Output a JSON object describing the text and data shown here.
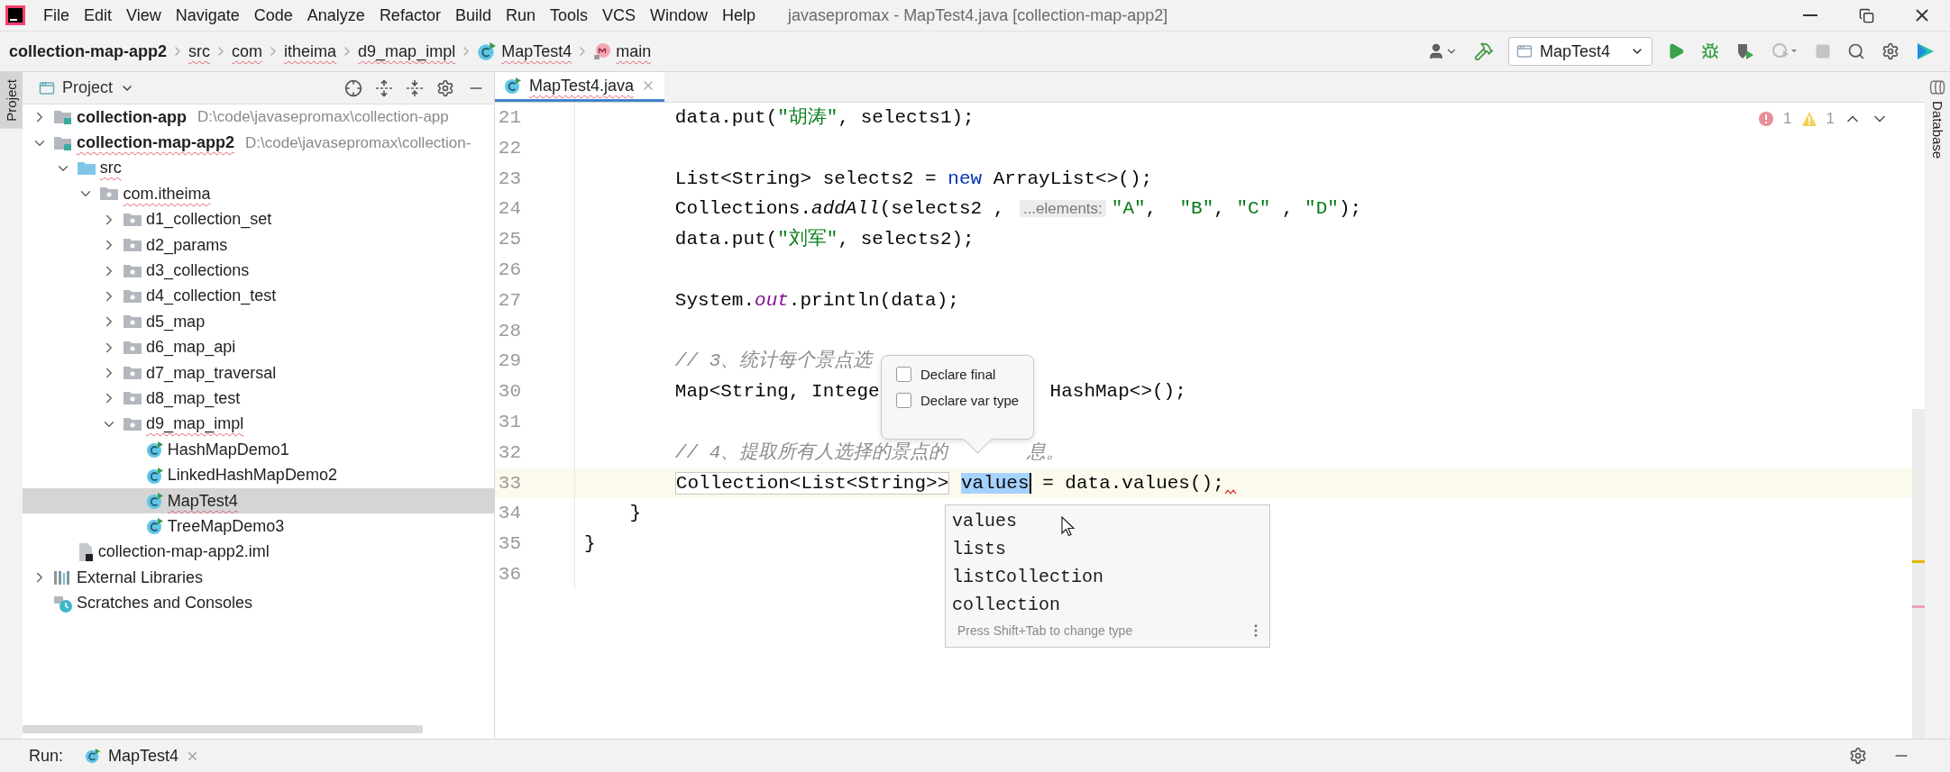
{
  "title_bar": {
    "menus": [
      "File",
      "Edit",
      "View",
      "Navigate",
      "Code",
      "Analyze",
      "Refactor",
      "Build",
      "Run",
      "Tools",
      "VCS",
      "Window",
      "Help"
    ],
    "title": "javasepromax - MapTest4.java [collection-map-app2]"
  },
  "breadcrumbs": [
    {
      "label": "collection-map-app2",
      "kind": "project",
      "error": false
    },
    {
      "label": "src",
      "kind": "folder",
      "error": true
    },
    {
      "label": "com",
      "kind": "folder",
      "error": true
    },
    {
      "label": "itheima",
      "kind": "folder",
      "error": true
    },
    {
      "label": "d9_map_impl",
      "kind": "folder",
      "error": true
    },
    {
      "label": "MapTest4",
      "kind": "class",
      "error": true
    },
    {
      "label": "main",
      "kind": "method",
      "error": true
    }
  ],
  "run_config": {
    "label": "MapTest4"
  },
  "left_stripe": {
    "label": "Project"
  },
  "project_panel": {
    "title": "Project",
    "tree": [
      {
        "label": "collection-app",
        "path": "D:\\code\\javasepromax\\collection-app",
        "kind": "module",
        "expanded": false,
        "selected": false,
        "error": false
      },
      {
        "label": "collection-map-app2",
        "path": "D:\\code\\javasepromax\\collection-",
        "kind": "module",
        "expanded": true,
        "selected": false,
        "error": true,
        "children": [
          {
            "label": "src",
            "kind": "source-folder",
            "expanded": true,
            "selected": false,
            "error": true,
            "children": [
              {
                "label": "com.itheima",
                "kind": "package",
                "expanded": true,
                "selected": false,
                "error": true,
                "children": [
                  {
                    "label": "d1_collection_set",
                    "kind": "package",
                    "expanded": false,
                    "selected": false,
                    "error": false
                  },
                  {
                    "label": "d2_params",
                    "kind": "package",
                    "expanded": false,
                    "selected": false,
                    "error": false
                  },
                  {
                    "label": "d3_collections",
                    "kind": "package",
                    "expanded": false,
                    "selected": false,
                    "error": false
                  },
                  {
                    "label": "d4_collection_test",
                    "kind": "package",
                    "expanded": false,
                    "selected": false,
                    "error": false
                  },
                  {
                    "label": "d5_map",
                    "kind": "package",
                    "expanded": false,
                    "selected": false,
                    "error": false
                  },
                  {
                    "label": "d6_map_api",
                    "kind": "package",
                    "expanded": false,
                    "selected": false,
                    "error": false
                  },
                  {
                    "label": "d7_map_traversal",
                    "kind": "package",
                    "expanded": false,
                    "selected": false,
                    "error": false
                  },
                  {
                    "label": "d8_map_test",
                    "kind": "package",
                    "expanded": false,
                    "selected": false,
                    "error": false
                  },
                  {
                    "label": "d9_map_impl",
                    "kind": "package",
                    "expanded": true,
                    "selected": false,
                    "error": true,
                    "children": [
                      {
                        "label": "HashMapDemo1",
                        "kind": "class",
                        "selected": false,
                        "error": false
                      },
                      {
                        "label": "LinkedHashMapDemo2",
                        "kind": "class",
                        "selected": false,
                        "error": false
                      },
                      {
                        "label": "MapTest4",
                        "kind": "class",
                        "selected": true,
                        "error": true
                      },
                      {
                        "label": "TreeMapDemo3",
                        "kind": "class",
                        "selected": false,
                        "error": false
                      }
                    ]
                  }
                ]
              }
            ]
          },
          {
            "label": "collection-map-app2.iml",
            "kind": "iml-file",
            "selected": false,
            "error": false
          }
        ]
      },
      {
        "label": "External Libraries",
        "kind": "libraries",
        "expanded": false,
        "selected": false,
        "error": false
      },
      {
        "label": "Scratches and Consoles",
        "kind": "scratches",
        "selected": false,
        "error": false
      }
    ]
  },
  "editor": {
    "tab": {
      "label": "MapTest4.java",
      "selected": true,
      "error": true
    },
    "problems": {
      "errors": "1",
      "warnings": "1"
    },
    "lines": [
      {
        "number": "21",
        "current": false,
        "tokens": [
          {
            "text": "        data.put(",
            "kind": "plain"
          },
          {
            "text": "\"胡涛\"",
            "kind": "string"
          },
          {
            "text": ", selects1);",
            "kind": "plain"
          }
        ]
      },
      {
        "number": "22",
        "current": false
      },
      {
        "number": "23",
        "current": false,
        "tokens": [
          {
            "text": "        List<String> selects2 = ",
            "kind": "plain"
          },
          {
            "text": "new",
            "kind": "keyword"
          },
          {
            "text": " ArrayList<>();",
            "kind": "plain"
          }
        ]
      },
      {
        "number": "24",
        "current": false,
        "tokens": [
          {
            "text": "        Collections.",
            "kind": "plain"
          },
          {
            "text": "addAll",
            "kind": "static"
          },
          {
            "text": "(selects2 , ",
            "kind": "plain"
          },
          {
            "text": "...elements:",
            "kind": "hint"
          },
          {
            "text": "\"A\"",
            "kind": "string"
          },
          {
            "text": ",  ",
            "kind": "plain"
          },
          {
            "text": "\"B\"",
            "kind": "string"
          },
          {
            "text": ", ",
            "kind": "plain"
          },
          {
            "text": "\"C\"",
            "kind": "string"
          },
          {
            "text": " , ",
            "kind": "plain"
          },
          {
            "text": "\"D\"",
            "kind": "string"
          },
          {
            "text": ");",
            "kind": "plain"
          }
        ]
      },
      {
        "number": "25",
        "current": false,
        "tokens": [
          {
            "text": "        data.put(",
            "kind": "plain"
          },
          {
            "text": "\"刘军\"",
            "kind": "string"
          },
          {
            "text": ", selects2);",
            "kind": "plain"
          }
        ]
      },
      {
        "number": "26",
        "current": false
      },
      {
        "number": "27",
        "current": false,
        "tokens": [
          {
            "text": "        System.",
            "kind": "plain"
          },
          {
            "text": "out",
            "kind": "field"
          },
          {
            "text": ".println(data);",
            "kind": "plain"
          }
        ]
      },
      {
        "number": "28",
        "current": false
      },
      {
        "number": "29",
        "current": false,
        "tokens": [
          {
            "text": "        // 3、统计每个景点选",
            "kind": "comment"
          }
        ]
      },
      {
        "number": "30",
        "current": false,
        "tokens": [
          {
            "text": "        Map<String, Intege",
            "kind": "plain"
          }
        ],
        "after": [
          {
            "text": "HashMap<>();",
            "kind": "plain"
          }
        ]
      },
      {
        "number": "31",
        "current": false
      },
      {
        "number": "32",
        "current": false,
        "tokens": [
          {
            "text": "        // 4、提取所有人选择的景点的",
            "kind": "comment"
          }
        ],
        "after": [
          {
            "text": "息。",
            "kind": "comment"
          }
        ]
      },
      {
        "number": "33",
        "current": true,
        "error_mark": true,
        "tokens": [
          {
            "text": "        Collection<List<String>>",
            "kind": "type-box"
          },
          {
            "text": " values",
            "kind": "selection"
          },
          {
            "text": " = data.values();",
            "kind": "plain"
          }
        ]
      },
      {
        "number": "34",
        "current": false,
        "tokens": [
          {
            "text": "    }",
            "kind": "plain"
          }
        ]
      },
      {
        "number": "35",
        "current": false,
        "tokens": [
          {
            "text": "}",
            "kind": "plain"
          }
        ]
      },
      {
        "number": "36",
        "current": false
      }
    ],
    "popup": {
      "options": [
        {
          "label": "Declare final",
          "checked": false
        },
        {
          "label": "Declare var type",
          "checked": false
        }
      ]
    },
    "completion": {
      "items": [
        "values",
        "lists",
        "listCollection",
        "collection"
      ],
      "hint": "Press Shift+Tab to change type"
    }
  },
  "right_stripe": {
    "label": "Database"
  },
  "run_bar": {
    "label": "Run:",
    "tab": "MapTest4"
  }
}
